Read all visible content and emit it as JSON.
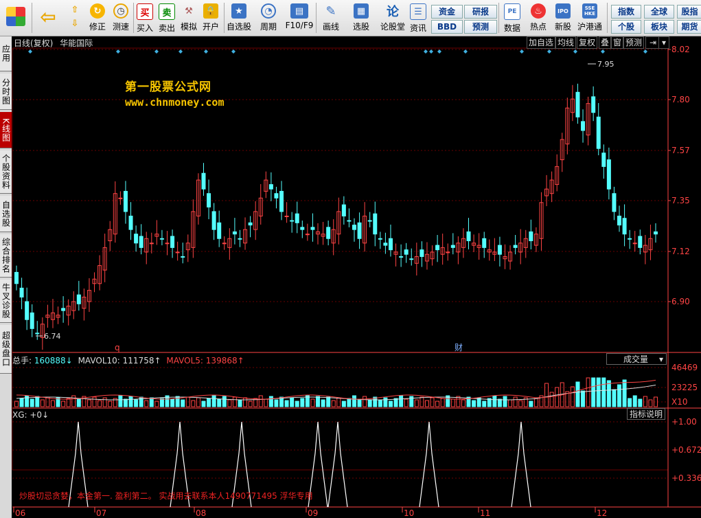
{
  "toolbar": {
    "buttons": [
      "修正",
      "测速",
      "买入",
      "卖出",
      "模拟",
      "开户",
      "自选股",
      "周期",
      "F10/F9",
      "画线",
      "选股",
      "论股堂",
      "资讯",
      "数据",
      "热点",
      "新股",
      "沪港通"
    ],
    "small_buttons": [
      "资金",
      "研报",
      "BBD",
      "预测",
      "指数",
      "全球",
      "股指",
      "个股",
      "板块",
      "期货"
    ]
  },
  "sidebar": {
    "tabs": [
      "应用",
      "分时图",
      "K线图",
      "个股资料",
      "自选股",
      "综合排名",
      "牛叉诊股",
      "超级盘口"
    ],
    "active": "K线图"
  },
  "header": {
    "title": "日线(复权)",
    "stock_name": "华能国际",
    "buttons": [
      "加自选",
      "均线",
      "复权",
      "叠",
      "窗",
      "预测"
    ]
  },
  "watermark": {
    "line1": "第一股票公式网",
    "line2": "www.chnmoney.com"
  },
  "price_axis": [
    "8.02",
    "7.80",
    "7.57",
    "7.35",
    "7.12",
    "6.90"
  ],
  "price_annotations": {
    "high": "7.95",
    "low": "6.74"
  },
  "event_markers": {
    "q_label": "q",
    "cai_label": "财"
  },
  "volume": {
    "total_label": "总手:",
    "total_value": "160888↓",
    "mavol10_label": "MAVOL10:",
    "mavol10_value": "111758↑",
    "mavol5_label": "MAVOL5:",
    "mavol5_value": "139868↑",
    "dropdown": "成交量",
    "axis": [
      "46469",
      "23225",
      "X10"
    ]
  },
  "indicator": {
    "label": "XG: +0↓",
    "explain_button": "指标说明",
    "axis": [
      "+1.00",
      "+0.672",
      "+0.336"
    ],
    "note": "炒股切忌贪婪，本金第一. 盈利第二。 实战用去联系本人1490771495 浮华专用"
  },
  "x_axis": [
    "06",
    "07",
    "08",
    "09",
    "10",
    "11",
    "12"
  ],
  "colors": {
    "up": "#ff4444",
    "down": "#54ffff",
    "grid": "#7a0000",
    "axis_text": "#ff4444"
  }
}
